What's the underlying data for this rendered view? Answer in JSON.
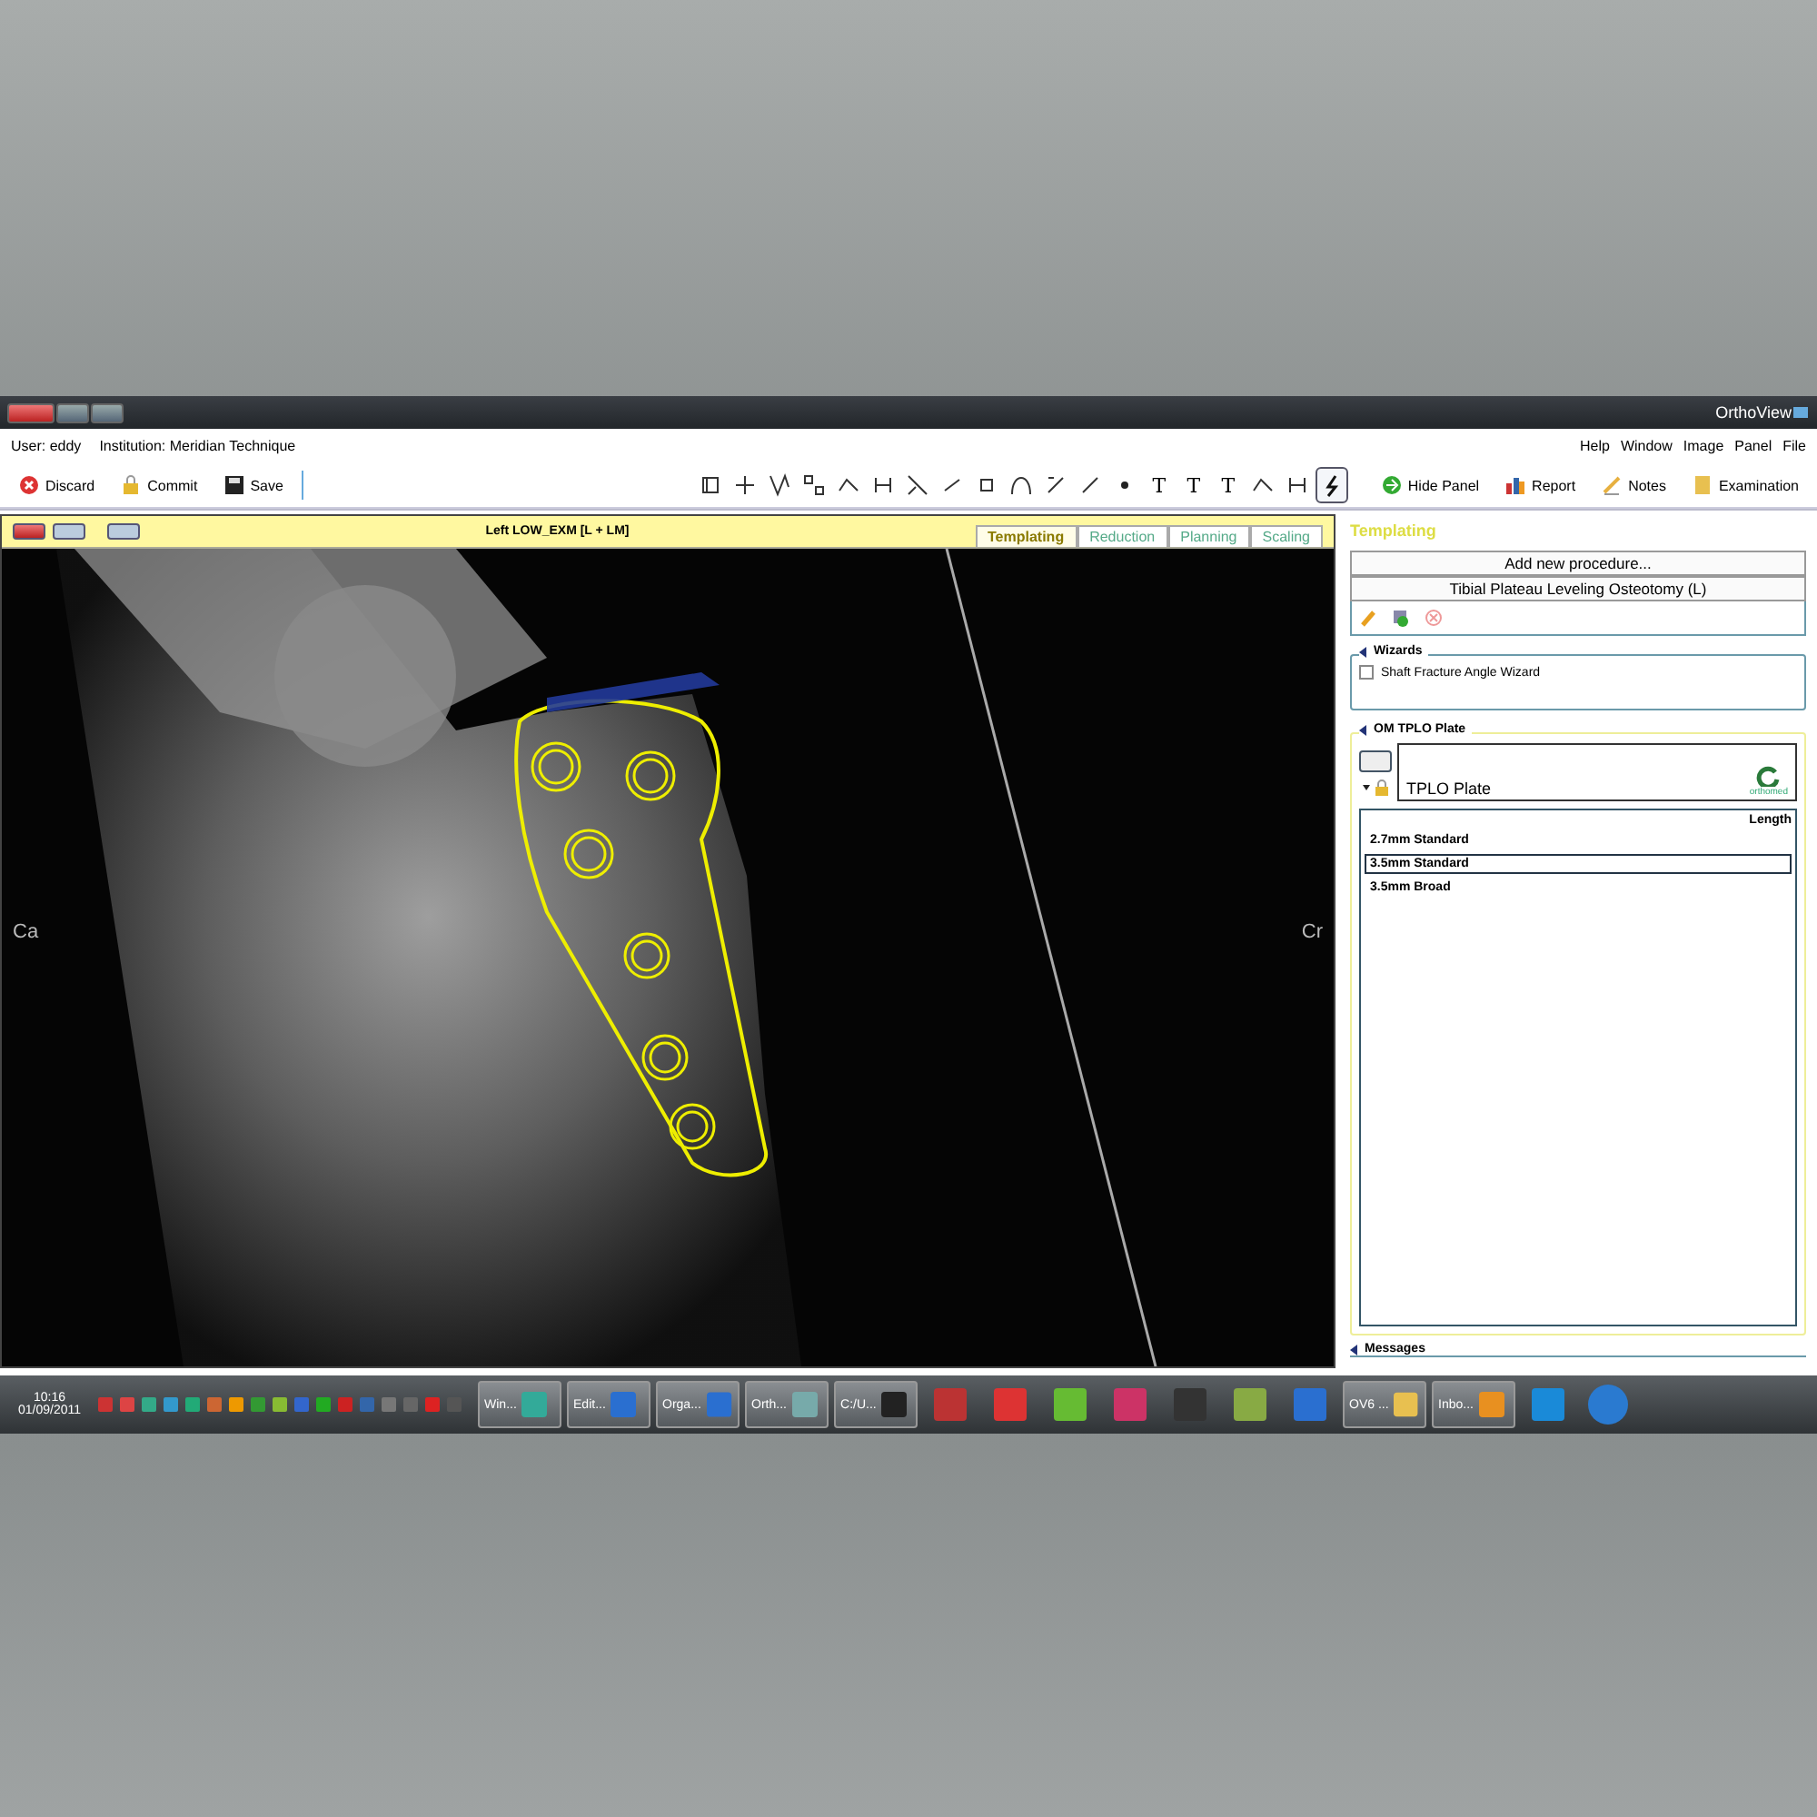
{
  "window": {
    "title": "OrthoView"
  },
  "menu": {
    "info": [
      {
        "label": "User: eddy"
      },
      {
        "label": "Institution: Meridian Technique"
      }
    ],
    "items": [
      "Help",
      "Window",
      "Image",
      "Panel",
      "File"
    ]
  },
  "toolbar": {
    "left": [
      {
        "label": "Discard",
        "kind": "discard"
      },
      {
        "label": "Commit",
        "kind": "commit"
      },
      {
        "label": "Save",
        "kind": "save"
      }
    ],
    "tools": [
      {
        "kind": "icon"
      },
      {
        "kind": "icon"
      },
      {
        "kind": "icon"
      },
      {
        "kind": "icon"
      },
      {
        "kind": "icon"
      },
      {
        "kind": "icon"
      },
      {
        "kind": "icon"
      },
      {
        "kind": "icon"
      },
      {
        "kind": "icon"
      },
      {
        "kind": "icon"
      },
      {
        "kind": "icon"
      },
      {
        "kind": "icon"
      },
      {
        "kind": "dot"
      },
      {
        "kind": "glyph",
        "glyph": "T"
      },
      {
        "kind": "glyph",
        "glyph": "T"
      },
      {
        "kind": "glyph",
        "glyph": "T"
      },
      {
        "kind": "icon"
      },
      {
        "kind": "icon"
      },
      {
        "kind": "icon",
        "selected": true
      }
    ],
    "right": [
      {
        "label": "Hide Panel",
        "kind": "hide"
      },
      {
        "label": "Report",
        "kind": "report"
      },
      {
        "label": "Notes",
        "kind": "notes"
      },
      {
        "label": "Examination",
        "kind": "exam"
      }
    ]
  },
  "viewer": {
    "title": "Left LOW_EXM [L + LM]",
    "tabs": [
      {
        "label": "Templating",
        "selected": true
      },
      {
        "label": "Reduction",
        "selected": false
      },
      {
        "label": "Planning",
        "selected": false
      },
      {
        "label": "Scaling",
        "selected": false
      }
    ],
    "left_marker": "Ca",
    "right_marker": "Cr"
  },
  "panel": {
    "title": "Templating",
    "procedure_placeholder": "Add new procedure...",
    "procedure": "Tibial Plateau Leveling Osteotomy (L)",
    "wizards": {
      "title": "Wizards",
      "items": [
        {
          "label": "Shaft Fracture Angle Wizard",
          "checked": false
        }
      ]
    },
    "plate": {
      "title": "OM TPLO Plate",
      "logo": "orthomed",
      "name": "TPLO Plate",
      "locked": true,
      "length": {
        "title": "Length",
        "items": [
          {
            "label": "2.7mm Standard",
            "selected": false
          },
          {
            "label": "3.5mm Standard",
            "selected": true
          },
          {
            "label": "3.5mm Broad",
            "selected": false
          }
        ]
      }
    },
    "messages": "Messages"
  },
  "taskbar": {
    "clock": {
      "time": "10:16",
      "date": "01/09/2011"
    },
    "tasks": [
      {
        "label": "Win...",
        "kind": "task",
        "color": "#3a9"
      },
      {
        "label": "Edit...",
        "kind": "task",
        "color": "#2a6fd0"
      },
      {
        "label": "Orga...",
        "kind": "task",
        "color": "#2a6fd0"
      },
      {
        "label": "Orth...",
        "kind": "task",
        "color": "#7aa"
      },
      {
        "label": "C:/U...",
        "kind": "task",
        "color": "#222"
      },
      {
        "kind": "pin",
        "color": "#b33"
      },
      {
        "kind": "pin",
        "color": "#d33"
      },
      {
        "kind": "pin",
        "color": "#6b3"
      },
      {
        "kind": "pin",
        "color": "#c36"
      },
      {
        "kind": "pin",
        "color": "#333"
      },
      {
        "kind": "pin",
        "color": "#8a4"
      },
      {
        "kind": "pin",
        "color": "#2a6fd0"
      },
      {
        "label": "OV6 ...",
        "kind": "task",
        "color": "#e8c050"
      },
      {
        "label": "Inbo...",
        "kind": "task",
        "color": "#e89020"
      },
      {
        "kind": "pin",
        "color": "#1a8ad8"
      },
      {
        "kind": "start",
        "color": "#2a7ad0"
      }
    ]
  }
}
